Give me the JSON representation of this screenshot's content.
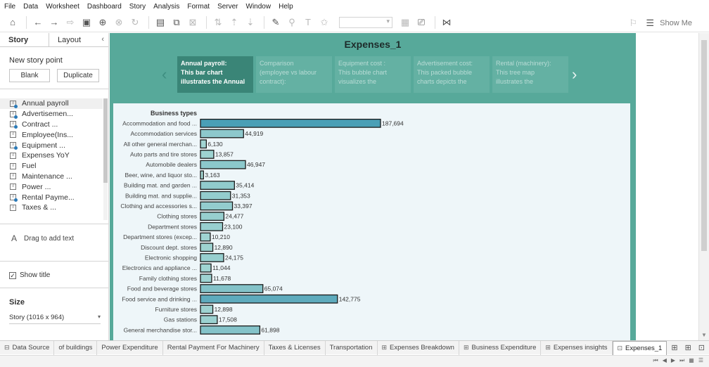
{
  "menu": [
    "File",
    "Data",
    "Worksheet",
    "Dashboard",
    "Story",
    "Analysis",
    "Format",
    "Server",
    "Window",
    "Help"
  ],
  "toolbar": {
    "show_me": "Show Me"
  },
  "left_panel": {
    "tabs": [
      "Story",
      "Layout"
    ],
    "new_story_point": "New story point",
    "blank_button": "Blank",
    "duplicate_button": "Duplicate",
    "sheets": [
      {
        "label": "Annual payroll",
        "dot": true
      },
      {
        "label": "Advertisemen...",
        "dot": true
      },
      {
        "label": "Contract ...",
        "dot": true
      },
      {
        "label": "Employee(Ins...",
        "dot": false
      },
      {
        "label": "Equipment ...",
        "dot": true
      },
      {
        "label": "Expenses YoY",
        "dot": false
      },
      {
        "label": "Fuel",
        "dot": false
      },
      {
        "label": "Maintenance ...",
        "dot": false
      },
      {
        "label": "Power ...",
        "dot": false
      },
      {
        "label": "Rental Payme...",
        "dot": true
      },
      {
        "label": "Taxes & ...",
        "dot": false
      }
    ],
    "drag_text": "Drag to add text",
    "show_title": "Show title",
    "size_label": "Size",
    "size_value": "Story (1016 x 964)"
  },
  "story": {
    "title": "Expenses_1",
    "points": [
      {
        "l1": "Annual payroll:",
        "l2": "This bar chart",
        "l3": "illustrates the Annual"
      },
      {
        "l1": "Comparison",
        "l2": "(employee vs  labour",
        "l3": "contract):"
      },
      {
        "l1": "Equipment cost :",
        "l2": "This bubble chart",
        "l3": "visualizes the"
      },
      {
        "l1": "Advertisement cost:",
        "l2": "This packed bubble",
        "l3": "charts depicts the"
      },
      {
        "l1": "Rental (machinery):",
        "l2": "This tree map",
        "l3": "illustrates the"
      }
    ]
  },
  "chart_data": {
    "type": "bar",
    "orientation": "horizontal",
    "row_header": "Business types",
    "categories": [
      "Accommodation and food ...",
      "Accommodation services",
      "All other general merchan...",
      "Auto parts and tire stores",
      "Automobile dealers",
      "Beer, wine, and liquor sto...",
      "Building mat. and garden ...",
      "Building mat. and supplie...",
      "Clothing and accessories s...",
      "Clothing stores",
      "Department stores",
      "Department stores (excep...",
      "Discount dept. stores",
      "Electronic shopping",
      "Electronics and appliance ...",
      "Family clothing stores",
      "Food and beverage stores",
      "Food service and drinking ...",
      "Furniture stores",
      "Gas stations",
      "General merchandise stor..."
    ],
    "values": [
      187694,
      44919,
      6130,
      13857,
      46947,
      3163,
      35414,
      31353,
      33397,
      24477,
      23100,
      10210,
      12890,
      24175,
      11044,
      11678,
      65074,
      142775,
      12898,
      17508,
      61898
    ],
    "value_labels": [
      "187,694",
      "44,919",
      "6,130",
      "13,857",
      "46,947",
      "3,163",
      "35,414",
      "31,353",
      "33,397",
      "24,477",
      "23,100",
      "10,210",
      "12,890",
      "24,175",
      "11,044",
      "11,678",
      "65,074",
      "142,775",
      "12,898",
      "17,508",
      "61,898"
    ],
    "colors": {
      "low": "#a6d8d4",
      "high": "#4a9fb6",
      "outline": "#1a1a1a"
    },
    "color_by": "value",
    "grid": false
  },
  "bottom_tabs": [
    {
      "label": "Data Source",
      "icon": "database-icon",
      "glyph": "⊟",
      "active": false
    },
    {
      "label": "of buildings",
      "icon": "",
      "glyph": "",
      "active": false
    },
    {
      "label": "Power Expenditure",
      "icon": "",
      "glyph": "",
      "active": false
    },
    {
      "label": "Rental Payment For Machinery",
      "icon": "",
      "glyph": "",
      "active": false
    },
    {
      "label": "Taxes & Licenses",
      "icon": "",
      "glyph": "",
      "active": false
    },
    {
      "label": "Transportation",
      "icon": "",
      "glyph": "",
      "active": false
    },
    {
      "label": "Expenses Breakdown",
      "icon": "dashboard-icon",
      "glyph": "⊞",
      "active": false
    },
    {
      "label": "Business Expenditure",
      "icon": "dashboard-icon",
      "glyph": "⊞",
      "active": false
    },
    {
      "label": "Expenses insights",
      "icon": "dashboard-icon",
      "glyph": "⊞",
      "active": false
    },
    {
      "label": "Expenses_1",
      "icon": "story-icon",
      "glyph": "⊡",
      "active": true
    }
  ]
}
